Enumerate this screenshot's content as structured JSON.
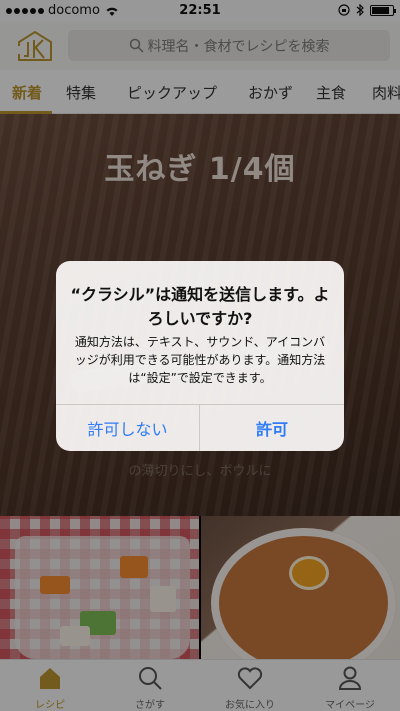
{
  "status_bar": {
    "carrier": "docomo",
    "time": "22:51"
  },
  "header": {
    "search_placeholder": "料理名・食材でレシピを検索"
  },
  "tabs": [
    {
      "label": "新着",
      "active": true
    },
    {
      "label": "特集"
    },
    {
      "label": "ピックアップ"
    },
    {
      "label": "おかず"
    },
    {
      "label": "主食"
    },
    {
      "label": "肉料"
    }
  ],
  "hero": {
    "title": "玉ねぎ 1/4個",
    "caption": "の薄切りにし、ボウルに"
  },
  "alert": {
    "title": "“クラシル”は通知を送信します。よろしいですか?",
    "message": "通知方法は、テキスト、サウンド、アイコンバッジが利用できる可能性があります。通知方法は“設定”で設定できます。",
    "deny_label": "許可しない",
    "allow_label": "許可"
  },
  "bottom_nav": [
    {
      "label": "レシピ",
      "icon": "home-icon",
      "active": true
    },
    {
      "label": "さがす",
      "icon": "search-icon"
    },
    {
      "label": "お気に入り",
      "icon": "heart-icon"
    },
    {
      "label": "マイページ",
      "icon": "person-icon"
    }
  ],
  "colors": {
    "accent": "#b8932f",
    "ios_blue": "#2f7cf6"
  }
}
